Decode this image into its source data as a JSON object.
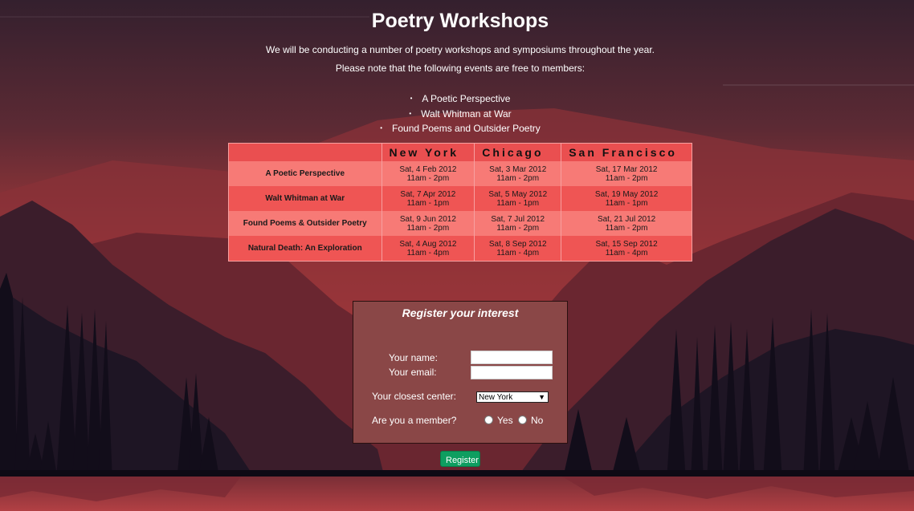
{
  "page": {
    "title": "Poetry Workshops",
    "intro_1": "We will be conducting a number of poetry workshops and symposiums throughout the year.",
    "intro_2": "Please note that the following events are free to members:"
  },
  "free_events": [
    "A Poetic Perspective",
    "Walt Whitman at War",
    "Found Poems and Outsider Poetry"
  ],
  "schedule": {
    "headers": [
      "",
      "New York",
      "Chicago",
      "San Francisco"
    ],
    "rows": [
      {
        "event": "A Poetic Perspective",
        "cells": [
          [
            "Sat, 4 Feb 2012",
            "11am - 2pm"
          ],
          [
            "Sat, 3 Mar 2012",
            "11am - 2pm"
          ],
          [
            "Sat, 17 Mar 2012",
            "11am - 2pm"
          ]
        ]
      },
      {
        "event": "Walt Whitman at War",
        "cells": [
          [
            "Sat, 7 Apr 2012",
            "11am - 1pm"
          ],
          [
            "Sat, 5 May 2012",
            "11am - 1pm"
          ],
          [
            "Sat, 19 May 2012",
            "11am - 1pm"
          ]
        ]
      },
      {
        "event": "Found Poems & Outsider Poetry",
        "cells": [
          [
            "Sat, 9 Jun 2012",
            "11am - 2pm"
          ],
          [
            "Sat, 7 Jul 2012",
            "11am - 2pm"
          ],
          [
            "Sat, 21 Jul 2012",
            "11am - 2pm"
          ]
        ]
      },
      {
        "event": "Natural Death: An Exploration",
        "cells": [
          [
            "Sat, 4 Aug 2012",
            "11am - 4pm"
          ],
          [
            "Sat, 8 Sep 2012",
            "11am - 4pm"
          ],
          [
            "Sat, 15 Sep 2012",
            "11am - 4pm"
          ]
        ]
      }
    ]
  },
  "form": {
    "heading": "Register your interest",
    "name_label": "Your name:",
    "name_value": "",
    "email_label": "Your email:",
    "email_value": "",
    "center_label": "Your closest center:",
    "center_value": "New York",
    "member_label": "Are you a member?",
    "yes_label": "Yes",
    "no_label": "No",
    "submit_label": "Register"
  },
  "colors": {
    "header_row": "#ea4f50",
    "row_light": "#f77a76",
    "row_dark": "#ef5554",
    "form_bg": "#8a4747",
    "button": "#0e9e60"
  }
}
